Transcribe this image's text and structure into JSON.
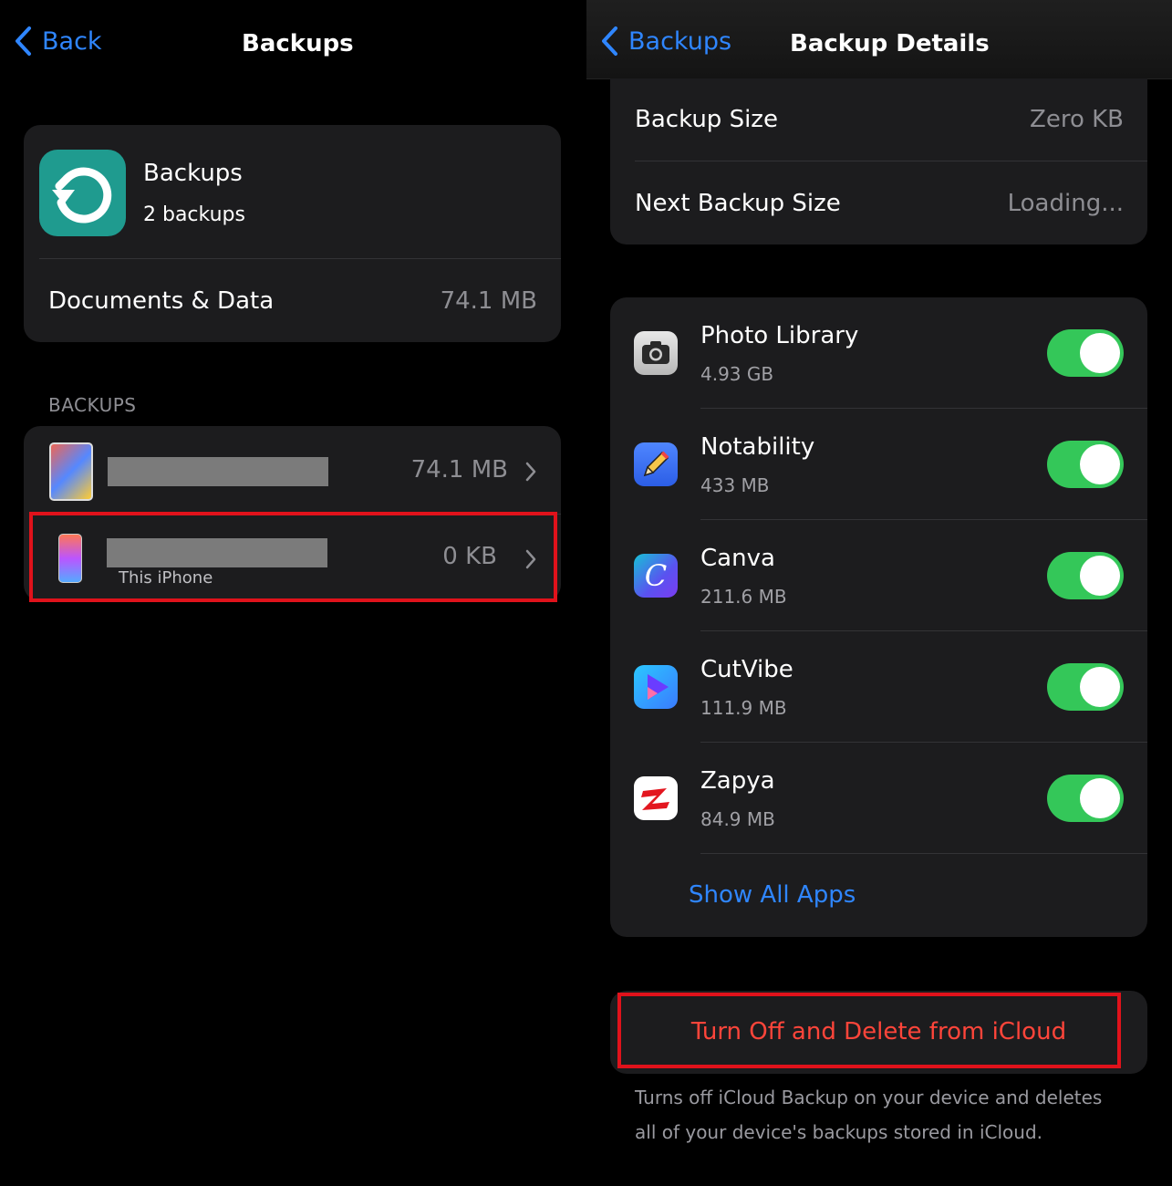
{
  "left": {
    "nav": {
      "back_label": "Back",
      "title": "Backups"
    },
    "summary": {
      "name": "Backups",
      "count": "2 backups",
      "docs_label": "Documents & Data",
      "docs_value": "74.1 MB"
    },
    "section_header": "BACKUPS",
    "backups": [
      {
        "size": "74.1 MB"
      },
      {
        "size": "0 KB",
        "subtitle": "This iPhone"
      }
    ]
  },
  "right": {
    "nav": {
      "back_label": "Backups",
      "title": "Backup Details"
    },
    "sizes": [
      {
        "label": "Backup Size",
        "value": "Zero KB"
      },
      {
        "label": "Next Backup Size",
        "value": "Loading..."
      }
    ],
    "apps": [
      {
        "name": "Photo Library",
        "size": "4.93 GB",
        "enabled": true,
        "icon": "camera-icon"
      },
      {
        "name": "Notability",
        "size": "433 MB",
        "enabled": true,
        "icon": "notability-icon"
      },
      {
        "name": "Canva",
        "size": "211.6 MB",
        "enabled": true,
        "icon": "canva-icon"
      },
      {
        "name": "CutVibe",
        "size": "111.9 MB",
        "enabled": true,
        "icon": "cutvibe-icon"
      },
      {
        "name": "Zapya",
        "size": "84.9 MB",
        "enabled": true,
        "icon": "zapya-icon"
      }
    ],
    "show_all": "Show All Apps",
    "delete_button": "Turn Off and Delete from iCloud",
    "footer": "Turns off iCloud Backup on your device and deletes all of your device's backups stored in iCloud."
  },
  "colors": {
    "accent": "#2f86ff",
    "toggle_on": "#34c759",
    "destructive": "#ff453a",
    "highlight": "#e0121b"
  }
}
